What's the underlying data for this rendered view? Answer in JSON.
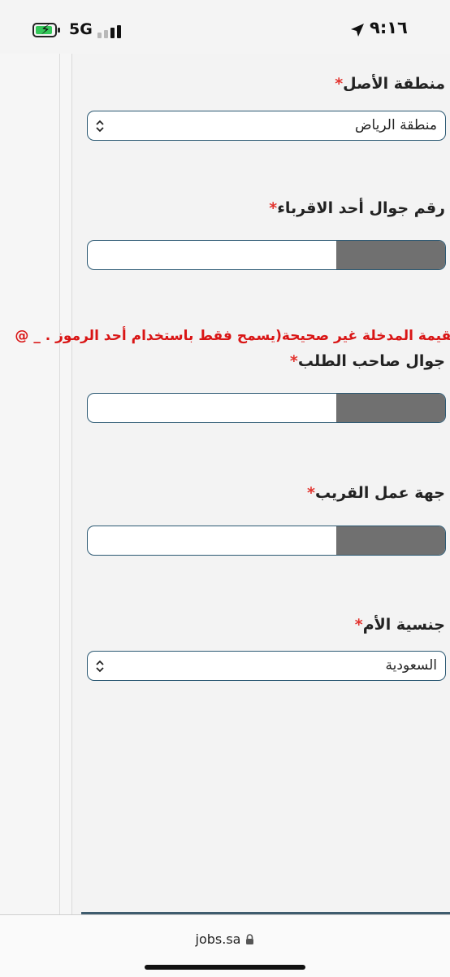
{
  "status_bar": {
    "time": "٩:١٦",
    "network": "5G",
    "battery_level": 0.7,
    "signal_bars_active": 2,
    "colors": {
      "battery": "#34c759"
    }
  },
  "form": {
    "required_mark": "*",
    "origin_region": {
      "label": "منطقة الأصل",
      "value": "منطقة الرياض"
    },
    "relative_phone": {
      "label": "رقم جوال أحد الاقرباء",
      "value": ""
    },
    "error_message": "القيمة المدخلة غير صحيحة(يسمح فقط باستخدام أحد الرموز . _ @",
    "applicant_phone": {
      "label": "جوال صاحب الطلب",
      "value": ""
    },
    "relative_employer": {
      "label": "جهة عمل القريب",
      "value": ""
    },
    "mother_nationality": {
      "label": "جنسية الأم",
      "value": "السعودية"
    }
  },
  "browser": {
    "url": "jobs.sa"
  },
  "colors": {
    "field_border": "#2c5973",
    "required": "#e3342f",
    "error": "#d91515",
    "redaction": "#707070"
  },
  "icons": {
    "location": "location-arrow-icon",
    "lock": "lock-icon",
    "select": "chevron-up-down-icon"
  }
}
